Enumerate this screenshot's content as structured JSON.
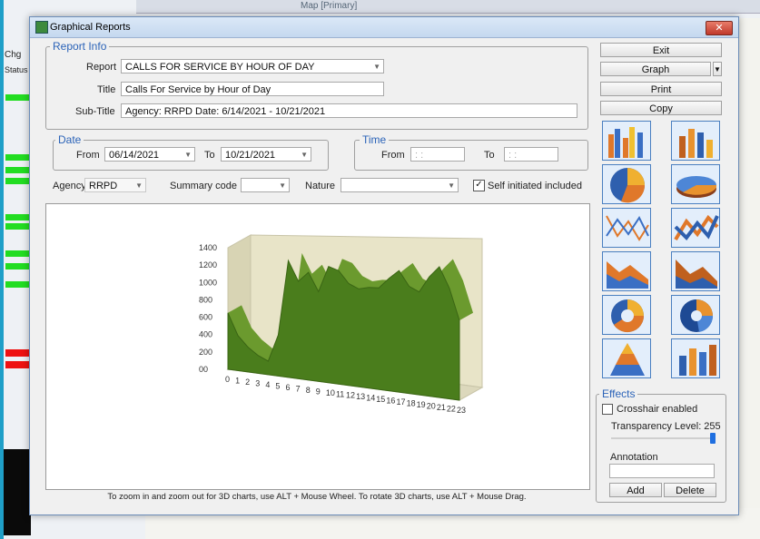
{
  "background": {
    "map_tab": "Map [Primary]",
    "left_labels": [
      "Chg",
      "Status"
    ]
  },
  "window": {
    "title": "Graphical Reports",
    "close_label": "✕"
  },
  "report_info": {
    "legend": "Report Info",
    "report_label": "Report",
    "report_value": "CALLS FOR SERVICE BY HOUR OF DAY",
    "title_label": "Title",
    "title_value": "Calls For Service by Hour of Day",
    "subtitle_label": "Sub-Title",
    "subtitle_value": "Agency: RRPD Date: 6/14/2021 - 10/21/2021"
  },
  "date": {
    "legend": "Date",
    "from_label": "From",
    "from_value": "06/14/2021",
    "to_label": "To",
    "to_value": "10/21/2021"
  },
  "time": {
    "legend": "Time",
    "from_label": "From",
    "from_value": " : : ",
    "to_label": "To",
    "to_value": " : : "
  },
  "filters": {
    "agency_label": "Agency",
    "agency_value": "RRPD",
    "summary_label": "Summary code",
    "summary_value": "",
    "nature_label": "Nature",
    "nature_value": "",
    "self_initiated_label": "Self initiated included",
    "self_initiated_checked": true
  },
  "side_buttons": {
    "exit": "Exit",
    "graph": "Graph",
    "print": "Print",
    "copy": "Copy"
  },
  "chart_icons": [
    "bar-chart-icon",
    "bar-3d-chart-icon",
    "pie-chart-icon",
    "pie-3d-chart-icon",
    "line-chart-icon",
    "line-3d-chart-icon",
    "area-chart-icon",
    "area-3d-chart-icon",
    "doughnut-chart-icon",
    "doughnut-3d-chart-icon",
    "pyramid-chart-icon",
    "cylinder-bar-chart-icon"
  ],
  "effects": {
    "legend": "Effects",
    "crosshair_label": "Crosshair enabled",
    "crosshair_checked": false,
    "transparency_label": "Transparency Level: 255",
    "transparency_level": 255,
    "annotation_label": "Annotation",
    "annotation_value": "",
    "add_label": "Add",
    "delete_label": "Delete"
  },
  "footnote": "To zoom in and zoom out for 3D charts, use ALT + Mouse Wheel.  To rotate 3D charts, use ALT + Mouse Drag.",
  "chart_data": {
    "type": "area",
    "x": [
      "0",
      "1",
      "2",
      "3",
      "4",
      "5",
      "6",
      "7",
      "8",
      "9",
      "10",
      "11",
      "12",
      "13",
      "14",
      "15",
      "16",
      "17",
      "18",
      "19",
      "20",
      "21",
      "22",
      "23"
    ],
    "values": [
      650,
      400,
      280,
      200,
      150,
      450,
      1270,
      1050,
      1150,
      950,
      1220,
      1180,
      1050,
      1000,
      1020,
      1020,
      1120,
      1200,
      1050,
      1000,
      1150,
      1250,
      1050,
      750
    ],
    "yticks": [
      "1400",
      "1200",
      "1000",
      "800",
      "600",
      "400",
      "200",
      "00"
    ],
    "ylim": [
      0,
      1400
    ],
    "fill_color": "#4a7d1c",
    "wall_color": "#e8e4c8"
  }
}
